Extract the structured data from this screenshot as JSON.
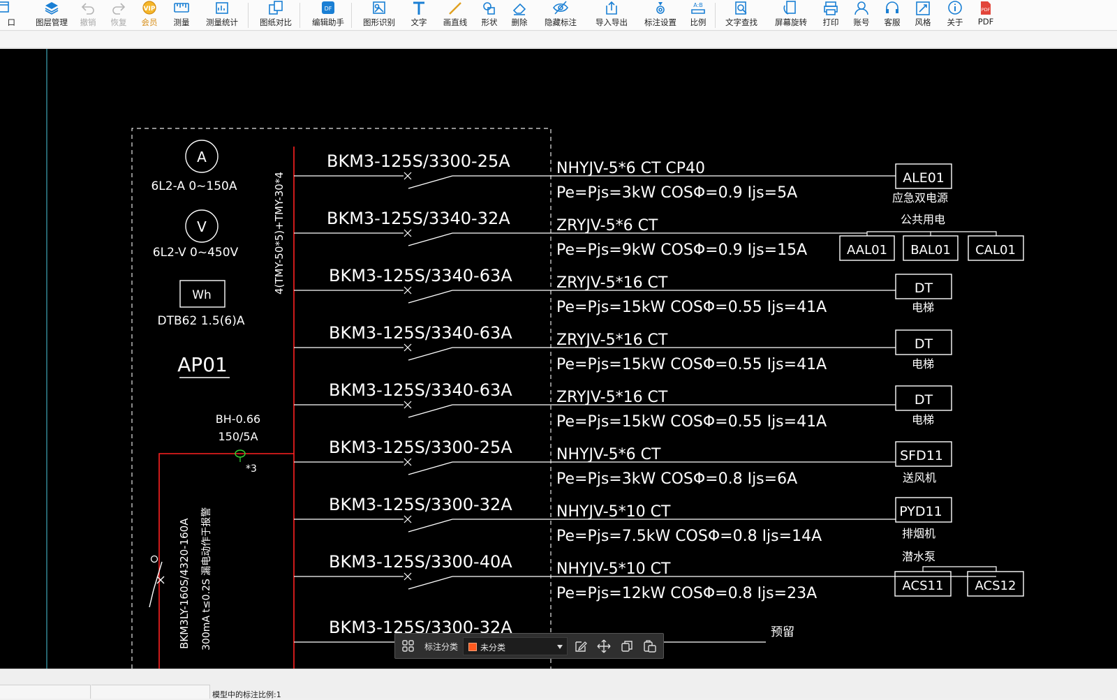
{
  "toolbar": {
    "items": [
      {
        "label": "窗口",
        "icon": "window-icon"
      },
      {
        "label": "图层管理",
        "icon": "layers-icon"
      },
      {
        "label": "撤销",
        "icon": "undo-icon"
      },
      {
        "label": "恢复",
        "icon": "redo-icon"
      },
      {
        "label": "会员",
        "icon": "vip-icon"
      },
      {
        "label": "测量",
        "icon": "ruler-icon"
      },
      {
        "label": "测量统计",
        "icon": "measure-stats-icon"
      },
      {
        "label": "图纸对比",
        "icon": "compare-icon"
      },
      {
        "label": "编辑助手",
        "icon": "edit-assistant-icon"
      },
      {
        "label": "图形识别",
        "icon": "shape-recognition-icon"
      },
      {
        "label": "文字",
        "icon": "text-icon"
      },
      {
        "label": "画直线",
        "icon": "line-icon"
      },
      {
        "label": "形状",
        "icon": "shape-icon"
      },
      {
        "label": "删除",
        "icon": "eraser-icon"
      },
      {
        "label": "隐藏标注",
        "icon": "hide-eye-icon"
      },
      {
        "label": "导入导出",
        "icon": "import-export-icon"
      },
      {
        "label": "标注设置",
        "icon": "annotation-settings-icon"
      },
      {
        "label": "比例",
        "icon": "scale-icon"
      },
      {
        "label": "文字查找",
        "icon": "text-search-icon"
      },
      {
        "label": "屏幕旋转",
        "icon": "rotate-screen-icon"
      },
      {
        "label": "打印",
        "icon": "printer-icon"
      },
      {
        "label": "账号",
        "icon": "account-icon"
      },
      {
        "label": "客服",
        "icon": "headset-icon"
      },
      {
        "label": "风格",
        "icon": "style-icon"
      },
      {
        "label": "关于",
        "icon": "info-icon"
      },
      {
        "label": "PDF",
        "icon": "pdf-icon"
      }
    ],
    "visible_labels": {
      "window": "口"
    }
  },
  "drawing": {
    "meter_a": "A",
    "meter_a_label": "6L2-A 0~150A",
    "meter_v": "V",
    "meter_v_label": "6L2-V 0~450V",
    "meter_wh": "Wh",
    "meter_wh_label": "DTB62 1.5(6)A",
    "panel_name": "AP01",
    "busbar_label": "4(TMY-50*5)+TMY-30*4",
    "ct_label_1": "BH-0.66",
    "ct_label_2": "150/5A",
    "ct_count": "*3",
    "main_breaker": "BKM3LY-160S/4320-160A",
    "main_breaker_note": "300mA t≤0.2S 漏电动作于报警",
    "circuits": [
      {
        "breaker": "BKM3-125S/3300-25A",
        "cable": "NHYJV-5*6   CT   CP40",
        "load": "Pe=Pjs=3kW COSΦ=0.9 Ijs=5A"
      },
      {
        "breaker": "BKM3-125S/3340-32A",
        "cable": "ZRYJV-5*6   CT",
        "load": "Pe=Pjs=9kW COSΦ=0.9 Ijs=15A"
      },
      {
        "breaker": "BKM3-125S/3340-63A",
        "cable": "ZRYJV-5*16  CT",
        "load": "Pe=Pjs=15kW COSΦ=0.55 Ijs=41A"
      },
      {
        "breaker": "BKM3-125S/3340-63A",
        "cable": "ZRYJV-5*16  CT",
        "load": "Pe=Pjs=15kW COSΦ=0.55 Ijs=41A"
      },
      {
        "breaker": "BKM3-125S/3340-63A",
        "cable": "ZRYJV-5*16  CT",
        "load": "Pe=Pjs=15kW COSΦ=0.55 Ijs=41A"
      },
      {
        "breaker": "BKM3-125S/3300-25A",
        "cable": "NHYJV-5*6  CT",
        "load": "Pe=Pjs=3kW COSΦ=0.8 Ijs=6A"
      },
      {
        "breaker": "BKM3-125S/3300-32A",
        "cable": "NHYJV-5*10  CT",
        "load": "Pe=Pjs=7.5kW COSΦ=0.8 Ijs=14A"
      },
      {
        "breaker": "BKM3-125S/3300-40A",
        "cable": "NHYJV-5*10  CT",
        "load": "Pe=Pjs=12kW COSΦ=0.8 Ijs=23A"
      },
      {
        "breaker": "BKM3-125S/3300-32A",
        "cable": "",
        "load": ""
      }
    ],
    "loads": {
      "ale01": "ALE01",
      "ale01_desc": "应急双电源",
      "public_desc": "公共用电",
      "aal01": "AAL01",
      "bal01": "BAL01",
      "cal01": "CAL01",
      "dt": "DT",
      "dt_desc": "电梯",
      "sfd11": "SFD11",
      "sfd11_desc": "送风机",
      "pyd11": "PYD11",
      "pyd11_desc": "排烟机",
      "pump_desc": "潜水泵",
      "acs11": "ACS11",
      "acs12": "ACS12",
      "spare": "预留"
    }
  },
  "floatbar": {
    "label": "标注分类",
    "select_value": "未分类",
    "swatch_color": "#ff5a1f"
  },
  "status": {
    "scale_text": "模型中的标注比例:1"
  },
  "colors": {
    "canvas_bg": "#000000",
    "cad_white": "#ffffff",
    "busbar_red": "#ff2020",
    "ct_green": "#33cc33",
    "accent_blue": "#1a7fd4"
  }
}
